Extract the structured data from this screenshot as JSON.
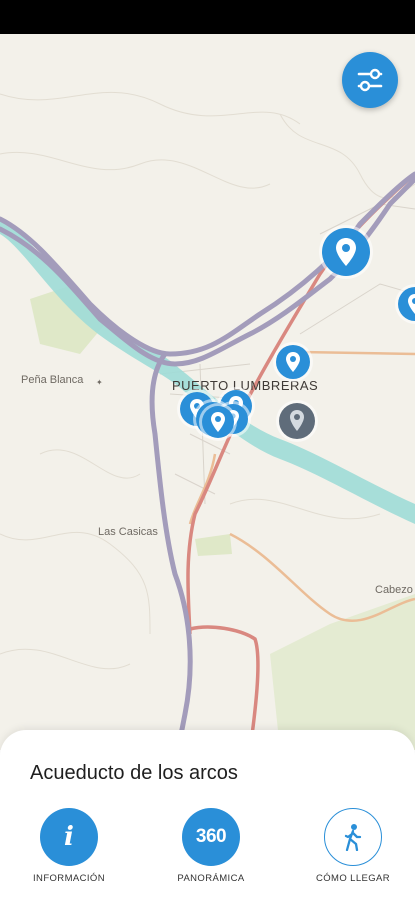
{
  "map": {
    "places": {
      "pena_blanca": "Peña Blanca",
      "town": "PUERTO LUMBRERAS",
      "las_casicas": "Las Casicas",
      "cabezo": "Cabezo"
    }
  },
  "icons": {
    "filter": "sliders-icon",
    "pin": "map-pin-icon",
    "info": "info-icon",
    "panoramic": "360-icon",
    "directions": "walking-person-icon"
  },
  "colors": {
    "accent": "#2a8fd8",
    "selected_pin": "#5f6c7a",
    "motorway": "#a09ab8",
    "main_road": "#d98880",
    "secondary_road": "#e9b48b",
    "river": "#8fd3d1"
  },
  "sheet": {
    "title": "Acueducto de los arcos",
    "actions": [
      {
        "label": "INFORMACIÓN",
        "icon_text": "i"
      },
      {
        "label": "PANORÁMICA",
        "icon_text": "360"
      },
      {
        "label": "CÓMO LLEGAR"
      }
    ]
  }
}
